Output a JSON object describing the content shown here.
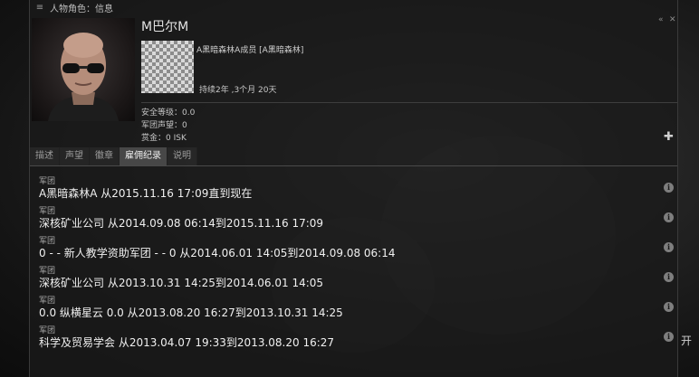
{
  "window": {
    "title": "人物角色：信息"
  },
  "character": {
    "name": "M巴尔M",
    "corp_line": "A黑暗森林A成员 [A黑暗森林]",
    "duration": "持续2年 ,3个月 20天",
    "stats": [
      "安全等级：0.0",
      "军团声望：0",
      "赏金：0 ISK"
    ]
  },
  "tabs": [
    {
      "label": "描述",
      "active": false
    },
    {
      "label": "声望",
      "active": false
    },
    {
      "label": "徽章",
      "active": false
    },
    {
      "label": "雇佣纪录",
      "active": true
    },
    {
      "label": "说明",
      "active": false
    }
  ],
  "employment": {
    "row_label": "军团",
    "entries": [
      "A黑暗森林A 从2015.11.16 17:09直到现在",
      "深核矿业公司 从2014.09.08 06:14到2015.11.16 17:09",
      "0 - - 新人教学资助军团 - - 0 从2014.06.01 14:05到2014.09.08 06:14",
      "深核矿业公司 从2013.10.31 14:25到2014.06.01 14:05",
      "0.0 纵横星云 0.0 从2013.08.20 16:27到2013.10.31 14:25",
      "科学及贸易学会 从2013.04.07 19:33到2013.08.20 16:27"
    ]
  },
  "background": {
    "right_text": "开"
  },
  "icons": {
    "menu": "menu-icon",
    "collapse": "collapse-icon",
    "close": "close-icon",
    "expand": "plus-icon",
    "info": "info-icon"
  }
}
